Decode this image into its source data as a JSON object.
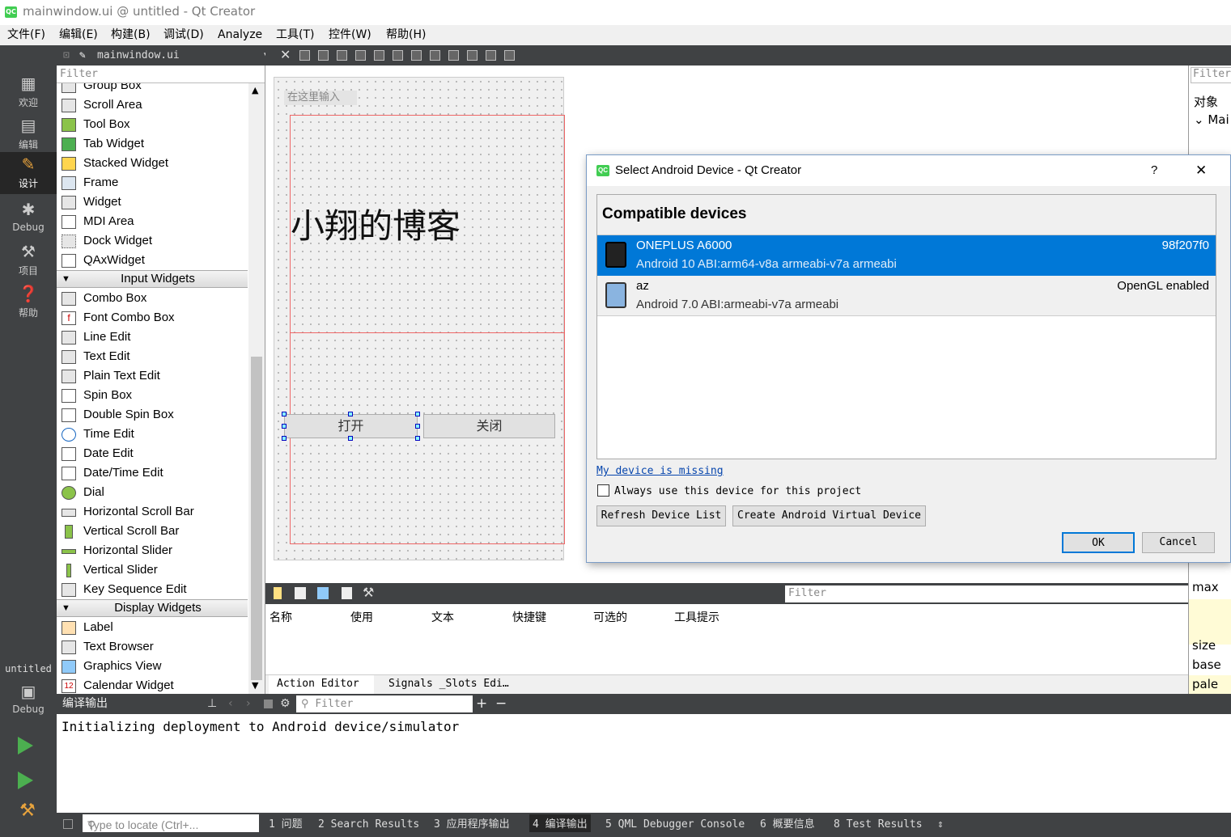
{
  "window": {
    "title": "mainwindow.ui @ untitled - Qt Creator",
    "app_icon": "QC"
  },
  "menu": [
    "文件(F)",
    "编辑(E)",
    "构建(B)",
    "调试(D)",
    "Analyze",
    "工具(T)",
    "控件(W)",
    "帮助(H)"
  ],
  "modes": [
    {
      "label": "欢迎",
      "icon": "grid-icon"
    },
    {
      "label": "编辑",
      "icon": "document-icon"
    },
    {
      "label": "设计",
      "icon": "pencil-icon"
    },
    {
      "label": "Debug",
      "icon": "bug-icon"
    },
    {
      "label": "项目",
      "icon": "wrench-icon"
    },
    {
      "label": "帮助",
      "icon": "help-icon"
    }
  ],
  "kit": {
    "project": "untitled",
    "config": "Debug"
  },
  "editor": {
    "file": "mainwindow.ui"
  },
  "widget_box": {
    "filter_placeholder": "Filter",
    "items_top": [
      "Group Box",
      "Scroll Area",
      "Tool Box",
      "Tab Widget",
      "Stacked Widget",
      "Frame",
      "Widget",
      "MDI Area",
      "Dock Widget",
      "QAxWidget"
    ],
    "cat_input": "Input Widgets",
    "items_input": [
      "Combo Box",
      "Font Combo Box",
      "Line Edit",
      "Text Edit",
      "Plain Text Edit",
      "Spin Box",
      "Double Spin Box",
      "Time Edit",
      "Date Edit",
      "Date/Time Edit",
      "Dial",
      "Horizontal Scroll Bar",
      "Vertical Scroll Bar",
      "Horizontal Slider",
      "Vertical Slider",
      "Key Sequence Edit"
    ],
    "cat_display": "Display Widgets",
    "items_display": [
      "Label",
      "Text Browser",
      "Graphics View",
      "Calendar Widget"
    ]
  },
  "form": {
    "menu_placeholder": "在这里输入",
    "label": "小翔的博客",
    "btn_open": "打开",
    "btn_close": "关闭"
  },
  "dialog": {
    "title": "Select Android Device - Qt Creator",
    "help": "?",
    "close": "✕",
    "header": "Compatible devices",
    "devices": [
      {
        "name": "ONEPLUS A6000",
        "detail": "Android 10  ABI:arm64-v8a armeabi-v7a armeabi",
        "right": "98f207f0"
      },
      {
        "name": "az",
        "detail": "Android 7.0  ABI:armeabi-v7a armeabi",
        "right": "OpenGL enabled"
      }
    ],
    "missing_link": "My device is missing",
    "always_use": "Always use this device for this project",
    "refresh": "Refresh Device List",
    "create_avd": "Create Android Virtual Device",
    "ok": "OK",
    "cancel": "Cancel"
  },
  "right_panel": {
    "filter": "Filter",
    "object_header": "对象",
    "tree_item": "Mai",
    "props": [
      "max",
      "size",
      "base",
      "pale"
    ]
  },
  "action_editor": {
    "filter": "Filter",
    "columns": [
      "名称",
      "使用",
      "文本",
      "快捷键",
      "可选的",
      "工具提示"
    ],
    "tabs": [
      "Action Editor",
      "Signals _Slots Edi…"
    ]
  },
  "output": {
    "title": "编译输出",
    "filter": "Filter",
    "text": "Initializing deployment to Android device/simulator"
  },
  "statusbar": {
    "locate_placeholder": "Type to locate (Ctrl+...",
    "panes": [
      "1 问题",
      "2 Search Results",
      "3 应用程序输出",
      "4 编译输出",
      "5 QML Debugger Console",
      "6 概要信息",
      "8 Test Results"
    ]
  },
  "colors": {
    "selection": "#0078d7",
    "dark_bar": "#404244",
    "accent_qt": "#41cd52"
  }
}
